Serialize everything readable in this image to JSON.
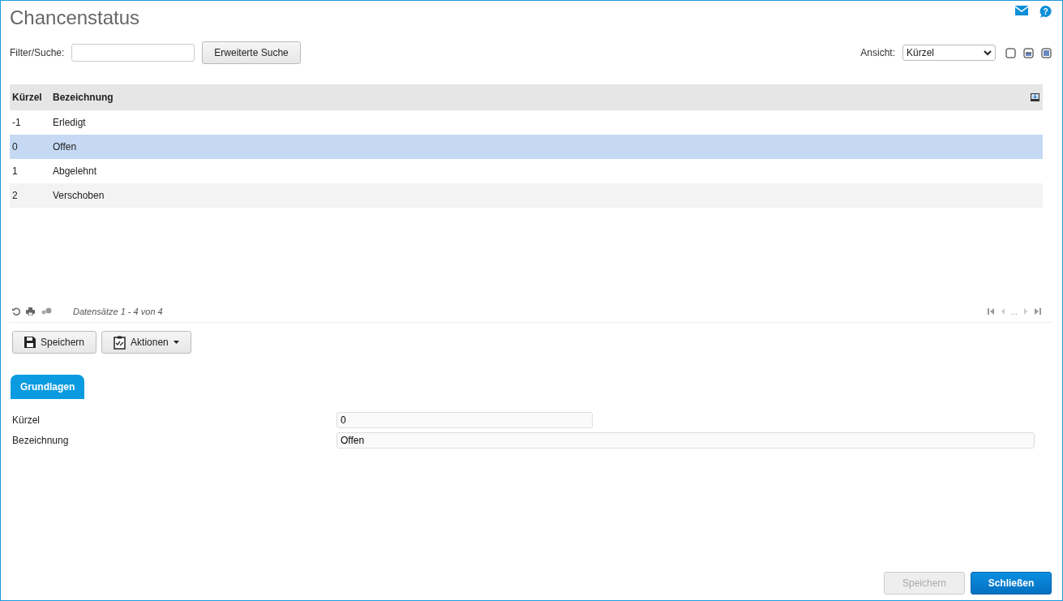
{
  "title": "Chancenstatus",
  "help_glyph": "?",
  "filter": {
    "label": "Filter/Suche:",
    "button": "Erweiterte Suche"
  },
  "view": {
    "label": "Ansicht:",
    "value": "Kürzel"
  },
  "table": {
    "columns": [
      "Kürzel",
      "Bezeichnung"
    ],
    "rows": [
      {
        "cells": [
          "-1",
          "Erledigt"
        ],
        "selected": false
      },
      {
        "cells": [
          "0",
          "Offen"
        ],
        "selected": true
      },
      {
        "cells": [
          "1",
          "Abgelehnt"
        ],
        "selected": false
      },
      {
        "cells": [
          "2",
          "Verschoben"
        ],
        "selected": false
      }
    ]
  },
  "records": "Datensätze 1 - 4 von 4",
  "pager_ellipsis": "...",
  "toolbar": [
    {
      "label": "Speichern",
      "kind": "save"
    },
    {
      "label": "Aktionen",
      "kind": "menu"
    }
  ],
  "tabs": [
    {
      "label": "Grundlagen",
      "selected": true
    }
  ],
  "fields": [
    {
      "label": "Kürzel",
      "value": "0",
      "kind": "short"
    },
    {
      "label": "Bezeichnung",
      "value": "Offen",
      "kind": "wide"
    }
  ],
  "buttons": [
    {
      "label": "Speichern",
      "disabled": true
    },
    {
      "label": "Schließen",
      "disabled": false
    }
  ]
}
